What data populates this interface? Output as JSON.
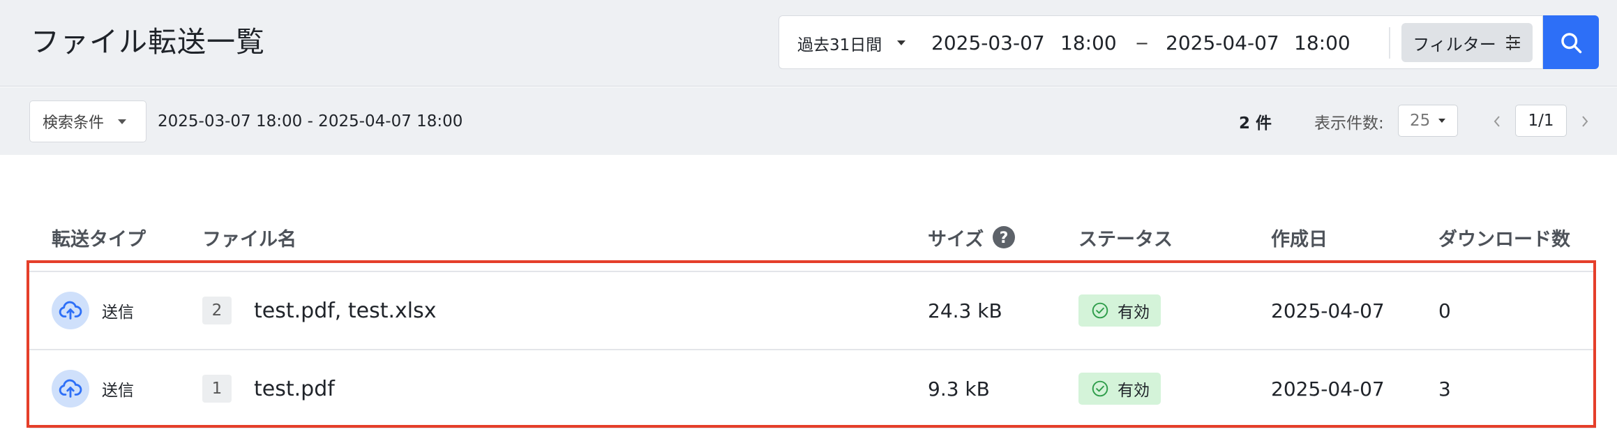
{
  "header": {
    "title": "ファイル転送一覧",
    "range_preset": "過去31日間",
    "start_date": "2025-03-07",
    "start_time": "18:00",
    "range_separator": "−",
    "end_date": "2025-04-07",
    "end_time": "18:00",
    "filter_label": "フィルター"
  },
  "subbar": {
    "condition_label": "検索条件",
    "condition_range": "2025-03-07 18:00 - 2025-04-07 18:00",
    "count": "2 件",
    "per_page_label": "表示件数:",
    "per_page_value": "25",
    "page": "1/1"
  },
  "table": {
    "columns": {
      "type": "転送タイプ",
      "name": "ファイル名",
      "size": "サイズ",
      "status": "ステータス",
      "created": "作成日",
      "downloads": "ダウンロード数"
    },
    "rows": [
      {
        "type": "送信",
        "file_count": "2",
        "file_name": "test.pdf, test.xlsx",
        "size": "24.3 kB",
        "status": "有効",
        "created": "2025-04-07",
        "downloads": "0"
      },
      {
        "type": "送信",
        "file_count": "1",
        "file_name": "test.pdf",
        "size": "9.3 kB",
        "status": "有効",
        "created": "2025-04-07",
        "downloads": "3"
      }
    ]
  },
  "colors": {
    "accent": "#2d6ff7",
    "status_bg": "#d4f3d9",
    "status_icon": "#2e9d4a",
    "highlight": "#e53f2a"
  },
  "icons": {
    "filter": "sliders-icon",
    "search": "search-icon",
    "help": "help-circle-icon",
    "upload": "cloud-upload-icon",
    "status": "check-circle-icon"
  }
}
